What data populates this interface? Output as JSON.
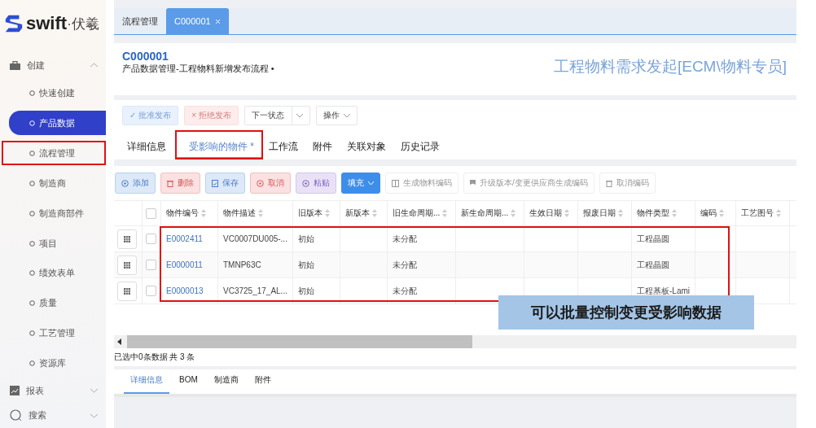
{
  "logo": {
    "brand": "swift",
    "suffix": "·伏羲"
  },
  "sidebar": {
    "items": [
      {
        "label": "创建",
        "expanded": true,
        "children": [
          {
            "label": "快速创建",
            "selected": false,
            "highlighted": false
          },
          {
            "label": "产品数据",
            "selected": true,
            "highlighted": false
          },
          {
            "label": "流程管理",
            "selected": false,
            "highlighted": true
          },
          {
            "label": "制造商",
            "selected": false,
            "highlighted": false
          },
          {
            "label": "制造商部件",
            "selected": false,
            "highlighted": false
          },
          {
            "label": "项目",
            "selected": false,
            "highlighted": false
          },
          {
            "label": "绩效表单",
            "selected": false,
            "highlighted": false
          },
          {
            "label": "质量",
            "selected": false,
            "highlighted": false
          },
          {
            "label": "工艺管理",
            "selected": false,
            "highlighted": false
          },
          {
            "label": "资源库",
            "selected": false,
            "highlighted": false
          }
        ]
      },
      {
        "label": "报表",
        "expanded": false
      },
      {
        "label": "搜索",
        "expanded": false
      }
    ]
  },
  "page_tabs": [
    {
      "label": "流程管理",
      "selected": false,
      "closable": false
    },
    {
      "label": "C000001",
      "selected": true,
      "closable": true
    }
  ],
  "header": {
    "code": "C000001",
    "subtitle": "产品数据管理-工程物料新增发布流程 •",
    "role": "工程物料需求发起[ECM\\物料专员]"
  },
  "actions": [
    {
      "kind": "approve",
      "label": "✓ 批准发布",
      "disabled": true
    },
    {
      "kind": "reject",
      "label": "× 拒绝发布",
      "disabled": true
    },
    {
      "kind": "split",
      "label": "下一状态",
      "disabled": false
    },
    {
      "kind": "menu",
      "label": "操作",
      "disabled": false
    }
  ],
  "tabs": [
    {
      "label": "详细信息",
      "selected": false,
      "highlighted": false
    },
    {
      "label": "受影响的物件 *",
      "selected": true,
      "highlighted": true
    },
    {
      "label": "工作流",
      "selected": false,
      "highlighted": false
    },
    {
      "label": "附件",
      "selected": false,
      "highlighted": false
    },
    {
      "label": "关联对象",
      "selected": false,
      "highlighted": false
    },
    {
      "label": "历史记录",
      "selected": false,
      "highlighted": false
    }
  ],
  "toolbar": [
    {
      "kind": "blue",
      "label": "添加",
      "disabled": false
    },
    {
      "kind": "red",
      "label": "删除",
      "disabled": false
    },
    {
      "kind": "blue",
      "label": "保存",
      "disabled": false
    },
    {
      "kind": "red",
      "label": "取消",
      "disabled": false
    },
    {
      "kind": "purple",
      "label": "粘贴",
      "disabled": false
    },
    {
      "kind": "solid",
      "label": "填充",
      "disabled": false
    },
    {
      "kind": "plain",
      "label": "生成物料编码",
      "disabled": true
    },
    {
      "kind": "plain",
      "label": "升级版本/变更供应商生成编码",
      "disabled": true
    },
    {
      "kind": "plain",
      "label": "取消编码",
      "disabled": true
    }
  ],
  "table": {
    "header_checked": false,
    "rows_highlighted": true,
    "columns": [
      "物件编号",
      "物件描述",
      "旧版本",
      "新版本",
      "旧生命周期...",
      "新生命周期...",
      "生效日期",
      "报废日期",
      "物件类型",
      "编码",
      "工艺图号"
    ],
    "rows": [
      {
        "checked": false,
        "cells": [
          "E0002411",
          "VC0007DU005-...",
          "初始",
          "",
          "未分配",
          "",
          "",
          "",
          "工程晶圆",
          "",
          ""
        ]
      },
      {
        "checked": false,
        "cells": [
          "E0000011",
          "TMNP63C",
          "初始",
          "",
          "未分配",
          "",
          "",
          "",
          "工程晶圆",
          "",
          ""
        ]
      },
      {
        "checked": false,
        "cells": [
          "E0000013",
          "VC3725_17_AL...",
          "初始",
          "",
          "未分配",
          "",
          "",
          "",
          "工程基板-Lami",
          "",
          ""
        ]
      }
    ],
    "status": "已选中0条数据 共 3 条"
  },
  "callout": "可以批量控制变更受影响数据",
  "bottom_tabs": [
    {
      "label": "详细信息",
      "selected": true
    },
    {
      "label": "BOM",
      "selected": false
    },
    {
      "label": "制造商",
      "selected": false
    },
    {
      "label": "附件",
      "selected": false
    }
  ]
}
